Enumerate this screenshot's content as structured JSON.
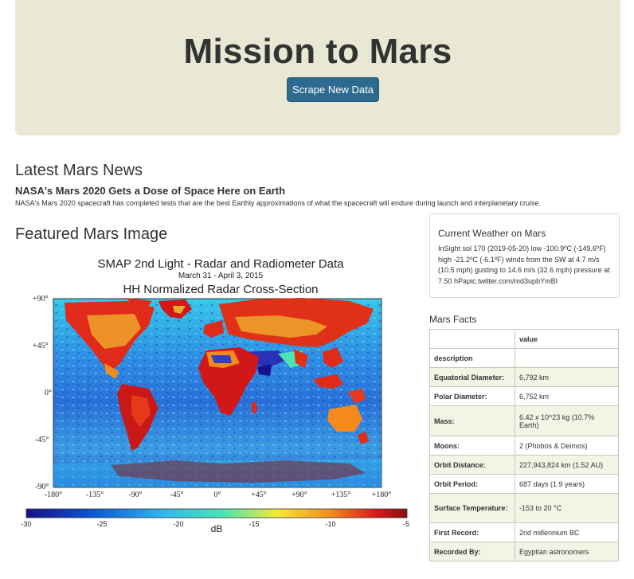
{
  "header": {
    "title": "Mission to Mars",
    "scrape_button": "Scrape New Data"
  },
  "news": {
    "heading": "Latest Mars News",
    "title": "NASA's Mars 2020 Gets a Dose of Space Here on Earth",
    "paragraph": "NASA's Mars 2020 spacecraft has completed tests that are the best Earthly approximations of what the spacecraft will endure during launch and interplanetary cruise."
  },
  "featured": {
    "heading": "Featured Mars Image",
    "image_title": "SMAP 2nd Light - Radar and Radiometer Data",
    "image_date": "March 31 - April 3, 2015",
    "image_subtitle": "HH Normalized Radar Cross-Section",
    "lat_ticks": [
      "+90°",
      "+45°",
      "0°",
      "-45°",
      "-90°"
    ],
    "lon_ticks": [
      "-180°",
      "-135°",
      "-90°",
      "-45°",
      "0°",
      "+45°",
      "+90°",
      "+135°",
      "+180°"
    ],
    "colorbar_ticks": [
      "-30",
      "-25",
      "-20",
      "-15",
      "-10",
      "-5"
    ],
    "colorbar_label": "dB",
    "colors": [
      "#1a0f8c",
      "#0a5ad6",
      "#2fb7f0",
      "#4be6b0",
      "#f5e834",
      "#f48a1c",
      "#d81818",
      "#8a0f0f"
    ]
  },
  "weather": {
    "heading": "Current Weather on Mars",
    "text": "InSight sol 170 (2019-05-20) low -100.9ºC (-149.6ºF) high -21.2ºC (-6.1ºF) winds from the SW at 4.7 m/s (10.5 mph) gusting to 14.6 m/s (32.6 mph) pressure at 7.50 hPapic.twitter.com/md3upbYmBI"
  },
  "facts": {
    "heading": "Mars Facts",
    "column_header": "value",
    "index_label": "description",
    "rows": [
      {
        "key": "Equatorial Diameter:",
        "value": "6,792 km"
      },
      {
        "key": "Polar Diameter:",
        "value": "6,752 km"
      },
      {
        "key": "Mass:",
        "value": "6.42 x 10^23 kg (10.7% Earth)"
      },
      {
        "key": "Moons:",
        "value": "2 (Phobos & Deimos)"
      },
      {
        "key": "Orbit Distance:",
        "value": "227,943,824 km (1.52 AU)"
      },
      {
        "key": "Orbit Period:",
        "value": "687 days (1.9 years)"
      },
      {
        "key": "Surface Temperature:",
        "value": "-153 to 20 °C"
      },
      {
        "key": "First Record:",
        "value": "2nd millennium BC"
      },
      {
        "key": "Recorded By:",
        "value": "Egyptian astronomers"
      }
    ]
  }
}
